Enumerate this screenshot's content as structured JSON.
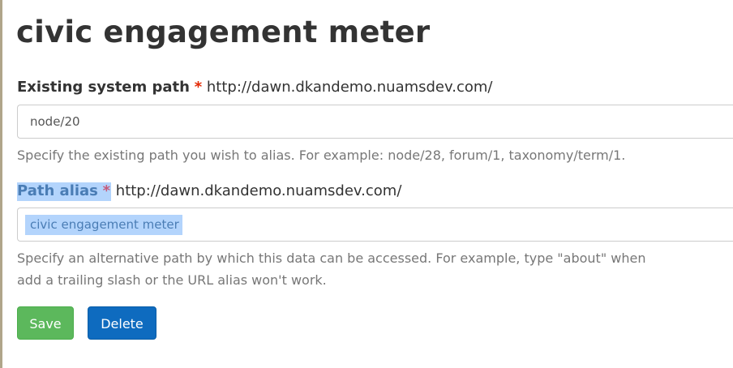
{
  "page": {
    "title": "civic engagement meter"
  },
  "source_field": {
    "label": "Existing system path",
    "required_marker": "*",
    "prefix": "http://dawn.dkandemo.nuamsdev.com/",
    "value": "node/20",
    "help": "Specify the existing path you wish to alias. For example: node/28, forum/1, taxonomy/term/1."
  },
  "alias_field": {
    "label": "Path alias",
    "required_marker": "*",
    "prefix": "http://dawn.dkandemo.nuamsdev.com/",
    "value": "civic engagement meter",
    "help_line1": "Specify an alternative path by which this data can be accessed. For example, type \"about\" when",
    "help_line2": "add a trailing slash or the URL alias won't work."
  },
  "actions": {
    "save_label": "Save",
    "delete_label": "Delete"
  },
  "colors": {
    "save_button": "#5cb85c",
    "delete_button": "#0e6bbf",
    "required_marker": "#e32700",
    "selection_highlight": "#b3d4fc"
  }
}
